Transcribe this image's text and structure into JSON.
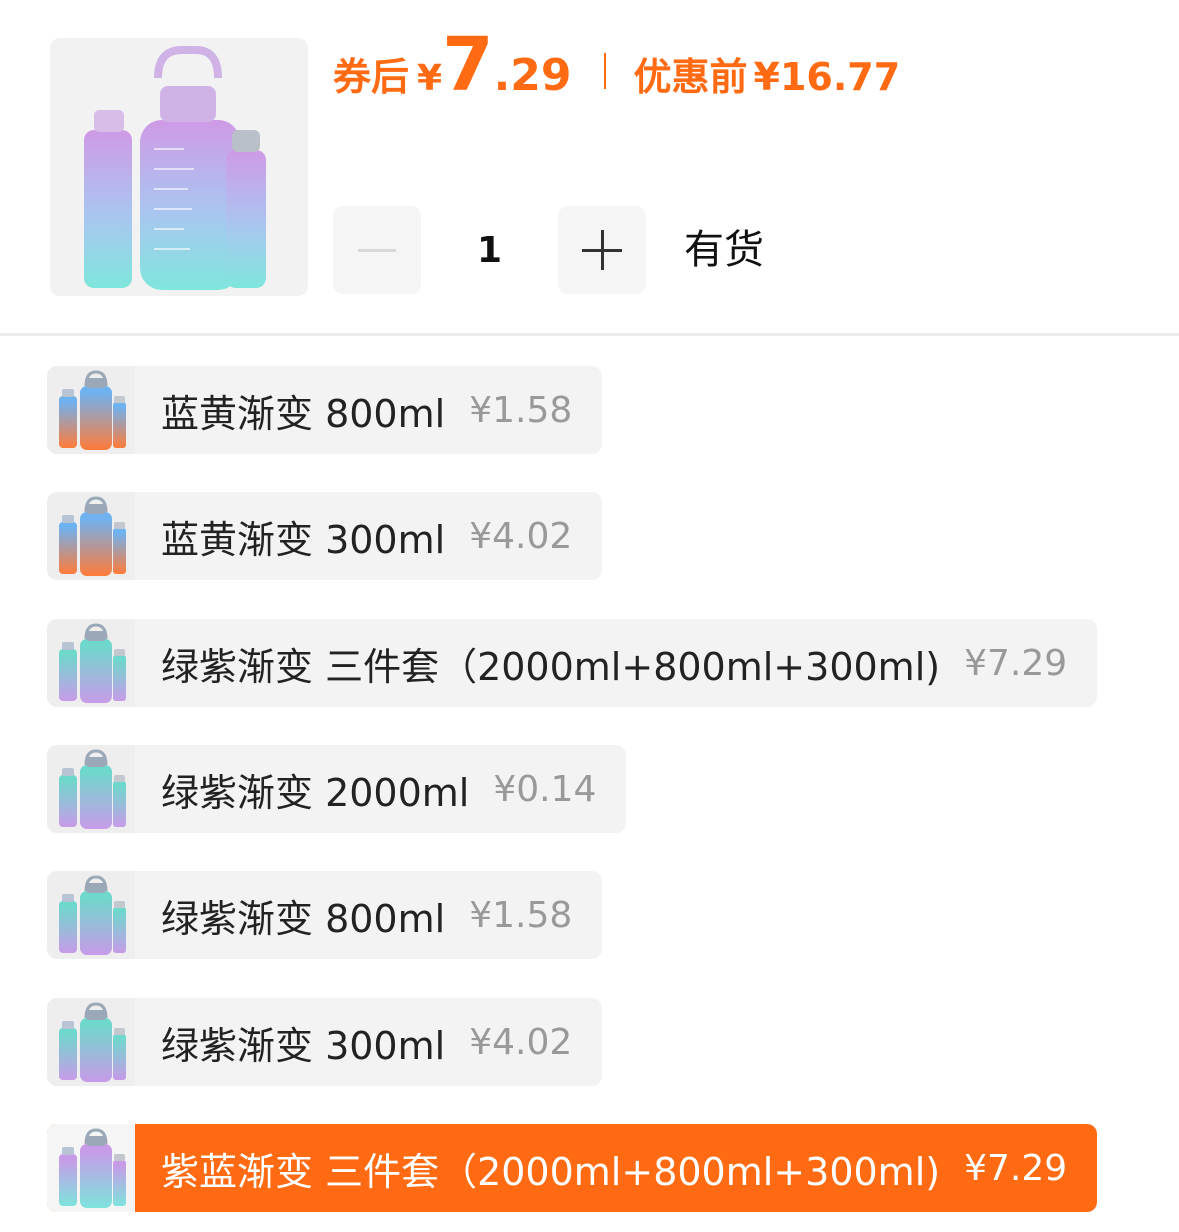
{
  "price": {
    "after_coupon_label": "券后",
    "currency": "¥",
    "after_coupon_int": "7",
    "after_coupon_dec": ".29",
    "before_discount_label": "优惠前",
    "before_discount_value": "¥16.77",
    "accent_color": "#ff6a12"
  },
  "quantity": {
    "value": "1",
    "stock_status": "有货"
  },
  "options": [
    {
      "label": "蓝黄渐变 800ml",
      "price": "¥1.58",
      "selected": false,
      "theme": "blue-orange"
    },
    {
      "label": "蓝黄渐变 300ml",
      "price": "¥4.02",
      "selected": false,
      "theme": "blue-orange"
    },
    {
      "label": "绿紫渐变 三件套（2000ml+800ml+300ml)",
      "price": "¥7.29",
      "selected": false,
      "theme": "teal-purple"
    },
    {
      "label": "绿紫渐变 2000ml",
      "price": "¥0.14",
      "selected": false,
      "theme": "teal-purple"
    },
    {
      "label": "绿紫渐变 800ml",
      "price": "¥1.58",
      "selected": false,
      "theme": "teal-purple"
    },
    {
      "label": "绿紫渐变 300ml",
      "price": "¥4.02",
      "selected": false,
      "theme": "teal-purple"
    },
    {
      "label": "紫蓝渐变 三件套（2000ml+800ml+300ml)",
      "price": "¥7.29",
      "selected": true,
      "theme": "purple-teal"
    }
  ],
  "themes": {
    "blue-orange": [
      "#6fb2f0",
      "#ff7b3a"
    ],
    "teal-purple": [
      "#6fd8cc",
      "#c79be8"
    ],
    "purple-teal": [
      "#c79be8",
      "#7fe3dc"
    ]
  }
}
